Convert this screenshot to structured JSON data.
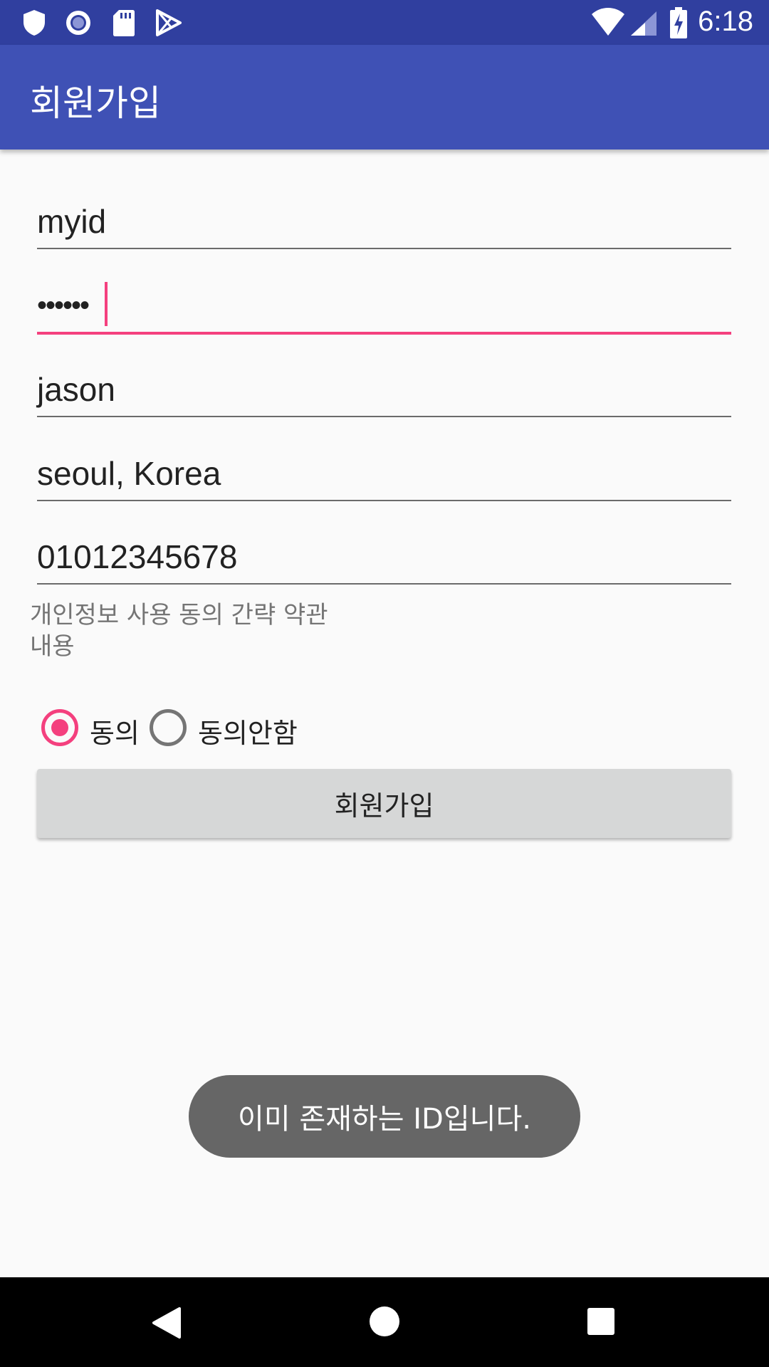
{
  "status_bar": {
    "time": "6:18",
    "left_icons": [
      "shield-icon",
      "record-icon",
      "sd-card-icon",
      "play-store-icon"
    ],
    "right_icons": [
      "wifi-icon",
      "cell-signal-icon",
      "battery-charging-icon"
    ]
  },
  "app_bar": {
    "title": "회원가입",
    "color": "#3f51b5"
  },
  "form": {
    "id_value": "myid",
    "password_value": "••••••",
    "name_value": "jason",
    "address_value": "seoul, Korea",
    "phone_value": "01012345678"
  },
  "terms": {
    "text_line1": "개인정보 사용 동의 간략 약관",
    "text_line2": "내용"
  },
  "consent": {
    "agree_label": "동의",
    "disagree_label": "동의안함",
    "selected": "agree"
  },
  "submit_button": {
    "label": "회원가입"
  },
  "toast": {
    "message": "이미 존재하는 ID입니다."
  },
  "colors": {
    "accent": "#f4407e",
    "primary": "#3f51b5",
    "primary_dark": "#303f9f"
  },
  "nav_bar": {
    "icons": [
      "back-icon",
      "home-icon",
      "recents-icon"
    ]
  }
}
